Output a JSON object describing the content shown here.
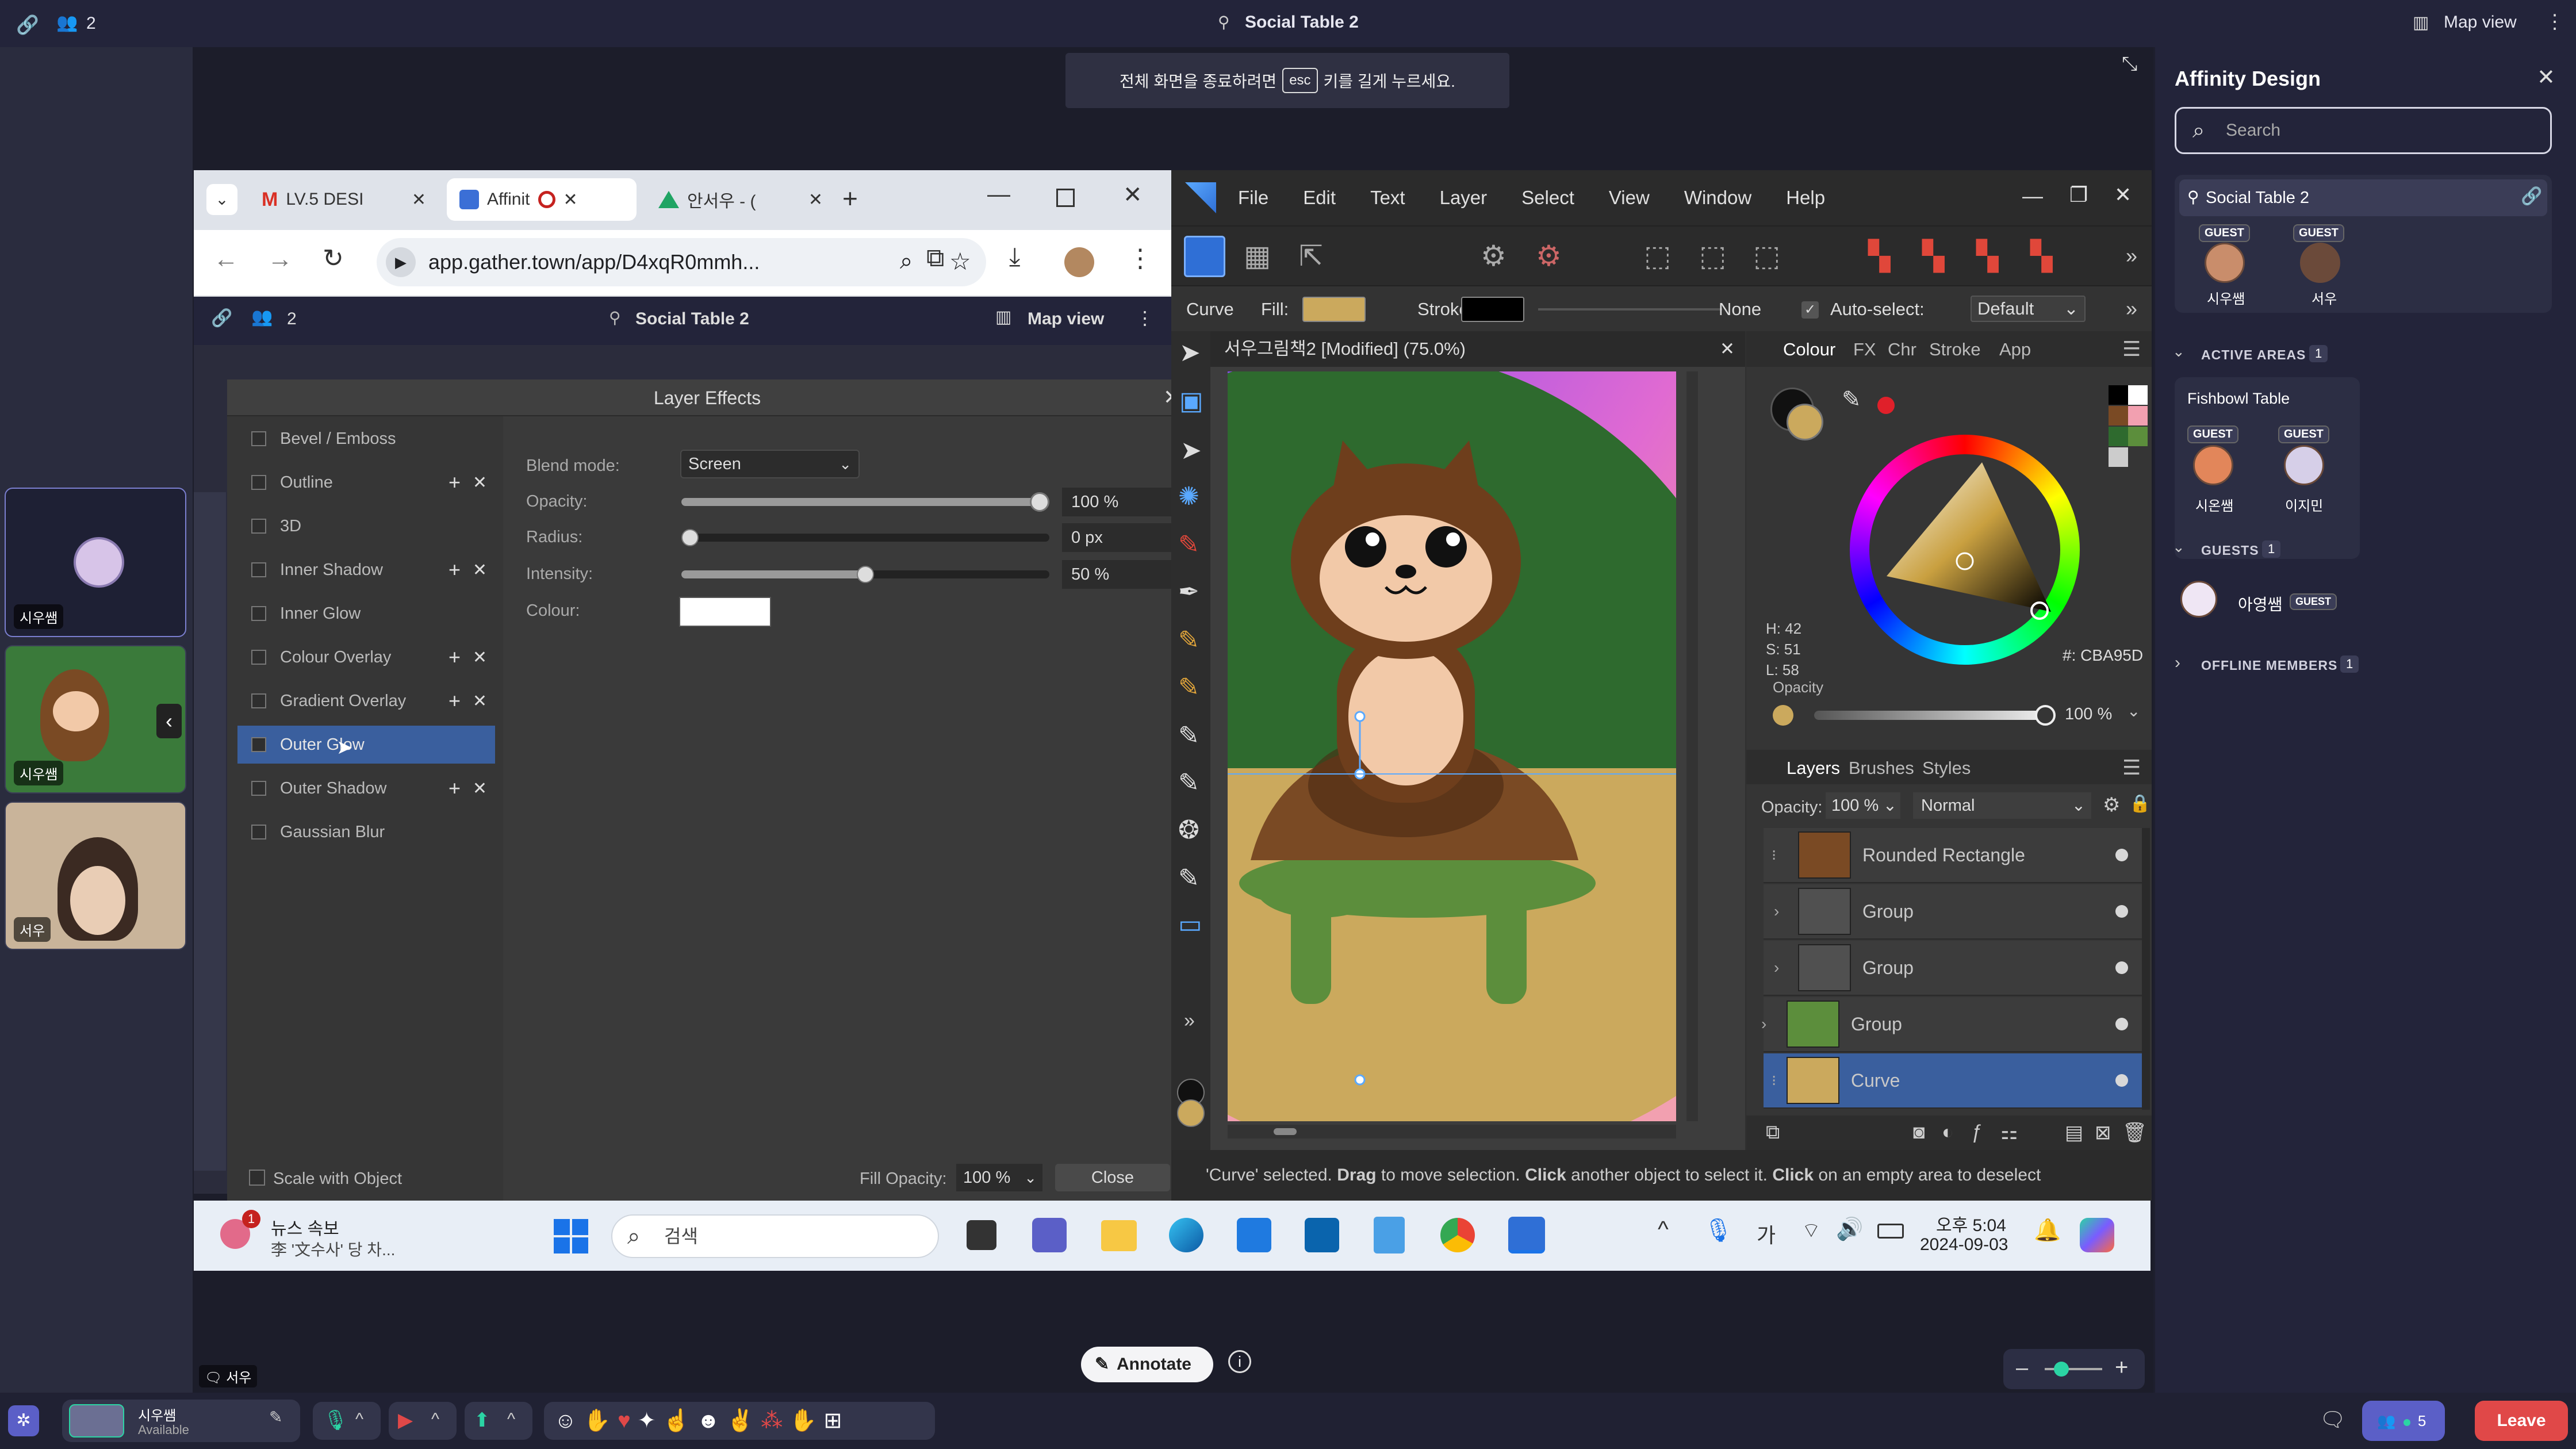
{
  "gather": {
    "top": {
      "participants": "2",
      "room": "Social Table 2",
      "map_view": "Map view"
    },
    "esc_notice": {
      "before": "전체 화면을 종료하려면",
      "key": "esc",
      "after": "키를 길게 누르세요."
    },
    "left_videos": [
      {
        "label": "시우쌤"
      },
      {
        "label": "시우쌤"
      },
      {
        "label": "서우"
      }
    ],
    "bottom": {
      "user_name": "시우쌤",
      "user_status": "Available",
      "annotate": "Annotate",
      "people_count": "5",
      "leave": "Leave",
      "speaker_label": "서우"
    }
  },
  "chrome": {
    "tabs": [
      {
        "label": "LV.5 DESI",
        "icon": "gmail-icon"
      },
      {
        "label": "Affinit",
        "icon": "affinity-icon",
        "active": true
      },
      {
        "label": "안서우 - (",
        "icon": "drive-icon"
      }
    ],
    "url": "app.gather.town/app/D4xqR0mmh...",
    "inner": {
      "participants": "2",
      "room": "Social Table 2",
      "map_view": "Map view"
    }
  },
  "layer_effects": {
    "title": "Layer Effects",
    "effects": [
      {
        "label": "Bevel / Emboss",
        "addable": false
      },
      {
        "label": "Outline",
        "addable": true
      },
      {
        "label": "3D",
        "addable": false
      },
      {
        "label": "Inner Shadow",
        "addable": true
      },
      {
        "label": "Inner Glow",
        "addable": false
      },
      {
        "label": "Colour Overlay",
        "addable": true
      },
      {
        "label": "Gradient Overlay",
        "addable": true
      },
      {
        "label": "Outer Glow",
        "addable": false,
        "selected": true
      },
      {
        "label": "Outer Shadow",
        "addable": true
      },
      {
        "label": "Gaussian Blur",
        "addable": false
      }
    ],
    "blend_mode_label": "Blend mode:",
    "blend_mode_value": "Screen",
    "opacity_label": "Opacity:",
    "opacity_value": "100 %",
    "opacity_level": 1.0,
    "radius_label": "Radius:",
    "radius_value": "0 px",
    "radius_level": 0.0,
    "intensity_label": "Intensity:",
    "intensity_value": "50 %",
    "intensity_level": 0.5,
    "colour_label": "Colour:",
    "colour_value": "#ffffff",
    "scale_with_object": "Scale with Object",
    "fill_opacity_label": "Fill Opacity:",
    "fill_opacity_value": "100 %",
    "close": "Close"
  },
  "affinity": {
    "menu": [
      "File",
      "Edit",
      "Text",
      "Layer",
      "Select",
      "View",
      "Window",
      "Help"
    ],
    "context": {
      "tool": "Curve",
      "fill_label": "Fill:",
      "fill_color": "#cba95d",
      "stroke_label": "Stroke:",
      "stroke_none": "None",
      "autoselect_label": "Auto-select:",
      "autoselect_value": "Default"
    },
    "document_tab": "서우그림책2 [Modified] (75.0%)",
    "colour_panel": {
      "tabs": [
        "Colour",
        "FX",
        "Chr",
        "Stroke",
        "App"
      ],
      "h": "H: 42",
      "s": "S: 51",
      "l": "L: 58",
      "hex": "#: CBA95D",
      "opacity_label": "Opacity",
      "opacity_value": "100 %"
    },
    "layers_panel": {
      "tabs": [
        "Layers",
        "Brushes",
        "Styles"
      ],
      "opacity_label": "Opacity:",
      "opacity_value": "100 %",
      "blend_mode": "Normal",
      "layers": [
        {
          "name": "Rounded Rectangle"
        },
        {
          "name": "Group"
        },
        {
          "name": "Group"
        },
        {
          "name": "Group"
        },
        {
          "name": "Curve",
          "selected": true
        }
      ]
    },
    "status": {
      "t1": "'Curve' selected. ",
      "b1": "Drag",
      "t2": " to move selection. ",
      "b2": "Click",
      "t3": " another object to select it. ",
      "b3": "Click",
      "t4": " on an empty area to deselect"
    }
  },
  "windows_taskbar": {
    "news_title": "뉴스 속보",
    "news_sub": "李 '文수사' 당 차...",
    "news_badge": "1",
    "search": "검색",
    "ime": "가",
    "time": "오후 5:04",
    "date": "2024-09-03"
  },
  "sidebar": {
    "title": "Affinity Design",
    "search_placeholder": "Search",
    "room": "Social Table 2",
    "room_members": [
      {
        "badge": "GUEST",
        "name": "시우쌤"
      },
      {
        "badge": "GUEST",
        "name": "서우"
      }
    ],
    "active_areas_label": "ACTIVE AREAS",
    "active_areas_count": "1",
    "fishbowl_title": "Fishbowl Table",
    "fishbowl_members": [
      {
        "badge": "GUEST",
        "name": "시온쌤"
      },
      {
        "badge": "GUEST",
        "name": "이지민"
      }
    ],
    "guests_label": "GUESTS",
    "guests_count": "1",
    "guest_name": "아영쌤",
    "guest_badge": "GUEST",
    "offline_label": "OFFLINE MEMBERS",
    "offline_count": "1"
  }
}
